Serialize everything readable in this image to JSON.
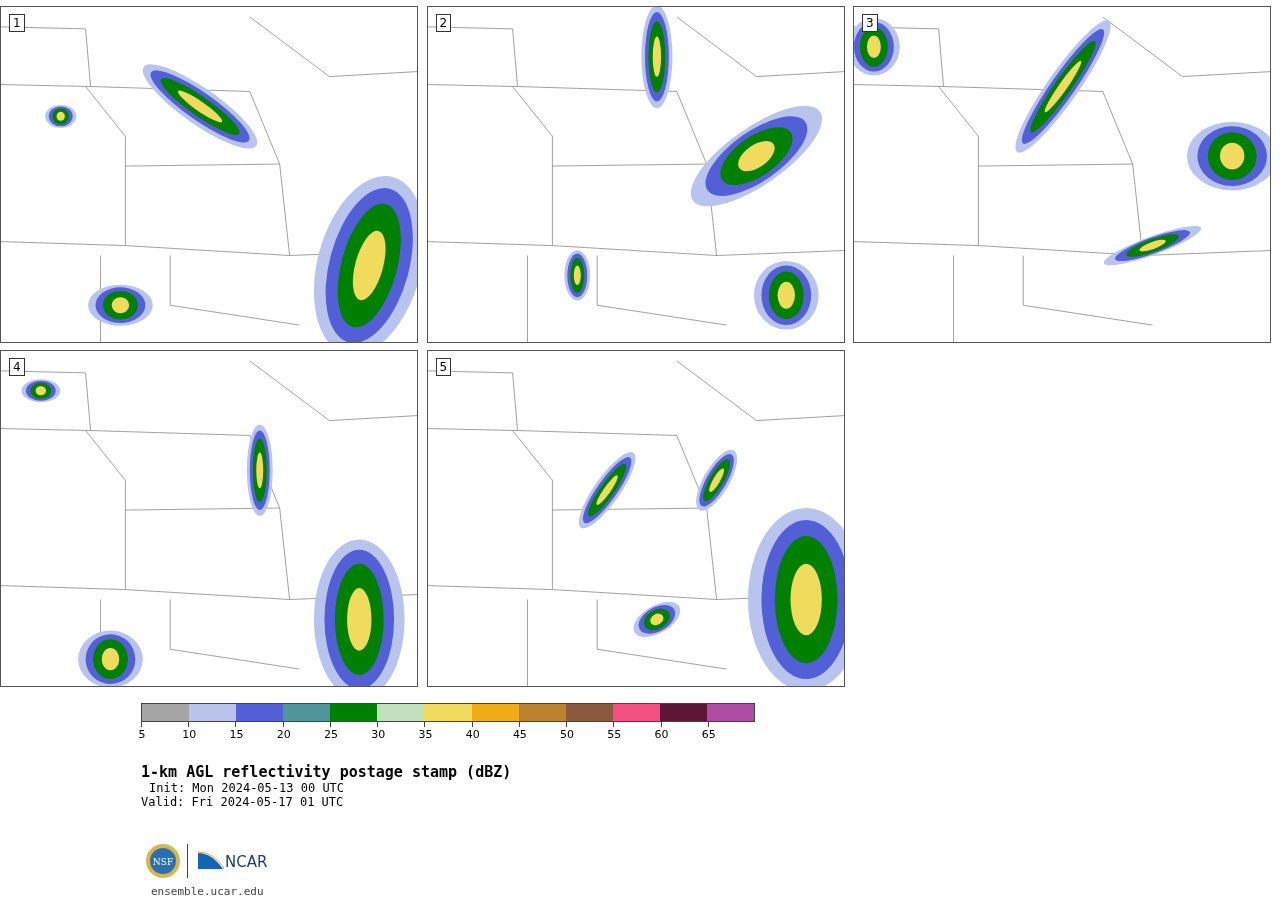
{
  "panels": [
    {
      "label": "1"
    },
    {
      "label": "2"
    },
    {
      "label": "3"
    },
    {
      "label": "4"
    },
    {
      "label": "5"
    }
  ],
  "colorbar": {
    "segments": [
      {
        "color": "#a5a5a5"
      },
      {
        "color": "#b8c3ee"
      },
      {
        "color": "#525fd6"
      },
      {
        "color": "#50969a"
      },
      {
        "color": "#008000"
      },
      {
        "color": "#bfdfbd"
      },
      {
        "color": "#f0db5c"
      },
      {
        "color": "#f0ac14"
      },
      {
        "color": "#bb8230"
      },
      {
        "color": "#8b5a3e"
      },
      {
        "color": "#f45082"
      },
      {
        "color": "#5e1636"
      },
      {
        "color": "#ae4ba2"
      }
    ],
    "ticks": [
      "5",
      "10",
      "15",
      "20",
      "25",
      "30",
      "35",
      "40",
      "45",
      "50",
      "55",
      "60",
      "65"
    ]
  },
  "title": "1-km AGL reflectivity postage stamp (dBZ)",
  "init": "Init: Mon 2024-05-13 00 UTC",
  "valid": "Valid: Fri 2024-05-17 01 UTC",
  "logos": {
    "nsf": "NSF",
    "ncar": "NCAR"
  },
  "url": "ensemble.ucar.edu"
}
